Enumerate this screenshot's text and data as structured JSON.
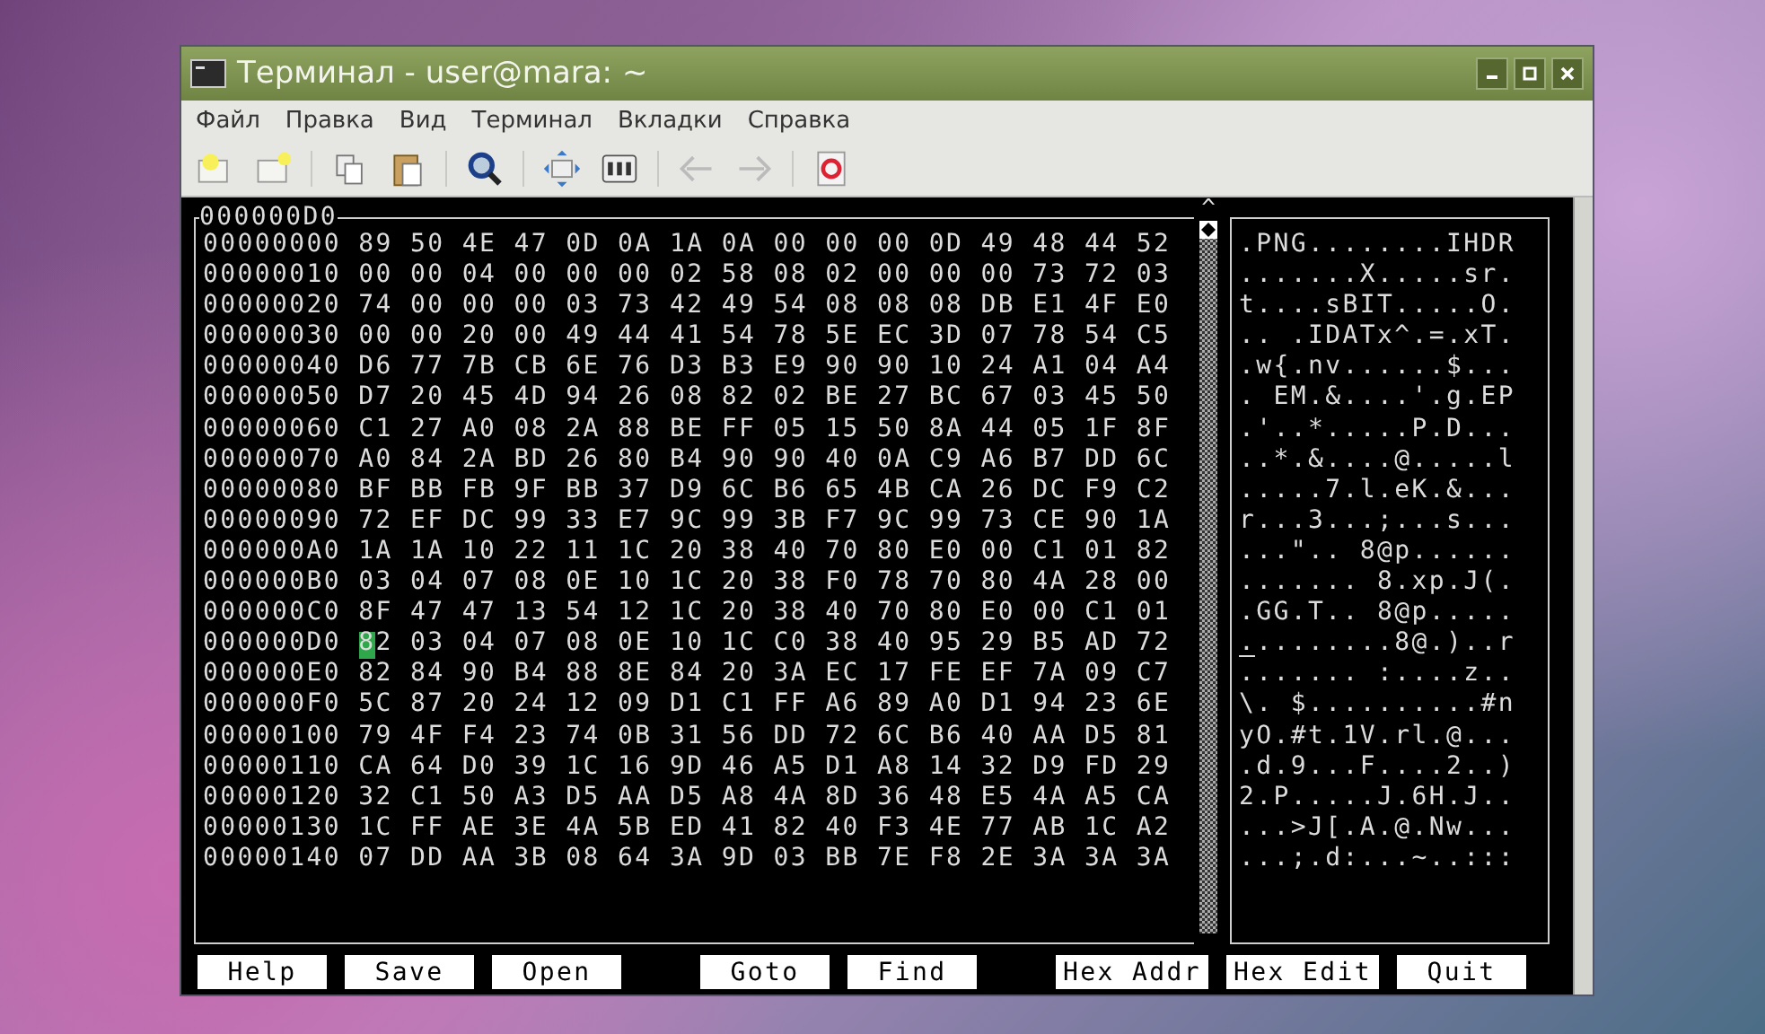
{
  "window": {
    "title": "Терминал - user@mara: ~"
  },
  "menu": [
    "Файл",
    "Правка",
    "Вид",
    "Терминал",
    "Вкладки",
    "Справка"
  ],
  "hex_editor": {
    "frame_label": "000000D0",
    "scroll_up": "^",
    "rows": [
      {
        "address": "00000000",
        "bytes": "89 50 4E 47 0D 0A 1A 0A 00 00 00 0D 49 48 44 52",
        "ascii": ".PNG........IHDR",
        "selected": false
      },
      {
        "address": "00000010",
        "bytes": "00 00 04 00 00 00 02 58 08 02 00 00 00 73 72 03",
        "ascii": ".......X.....sr.",
        "selected": false
      },
      {
        "address": "00000020",
        "bytes": "74 00 00 00 03 73 42 49 54 08 08 08 DB E1 4F E0",
        "ascii": "t....sBIT.....O.",
        "selected": false
      },
      {
        "address": "00000030",
        "bytes": "00 00 20 00 49 44 41 54 78 5E EC 3D 07 78 54 C5",
        "ascii": ".. .IDATx^.=.xT.",
        "selected": false
      },
      {
        "address": "00000040",
        "bytes": "D6 77 7B CB 6E 76 D3 B3 E9 90 90 10 24 A1 04 A4",
        "ascii": ".w{.nv......$...",
        "selected": false
      },
      {
        "address": "00000050",
        "bytes": "D7 20 45 4D 94 26 08 82 02 BE 27 BC 67 03 45 50",
        "ascii": ". EM.&....'.g.EP",
        "selected": false
      },
      {
        "address": "00000060",
        "bytes": "C1 27 A0 08 2A 88 BE FF 05 15 50 8A 44 05 1F 8F",
        "ascii": ".'..*.....P.D...",
        "selected": false
      },
      {
        "address": "00000070",
        "bytes": "A0 84 2A BD 26 80 B4 90 90 40 0A C9 A6 B7 DD 6C",
        "ascii": "..*.&....@.....l",
        "selected": false
      },
      {
        "address": "00000080",
        "bytes": "BF BB FB 9F BB 37 D9 6C B6 65 4B CA 26 DC F9 C2",
        "ascii": ".....7.l.eK.&...",
        "selected": false
      },
      {
        "address": "00000090",
        "bytes": "72 EF DC 99 33 E7 9C 99 3B F7 9C 99 73 CE 90 1A",
        "ascii": "r...3...;...s...",
        "selected": false
      },
      {
        "address": "000000A0",
        "bytes": "1A 1A 10 22 11 1C 20 38 40 70 80 E0 00 C1 01 82",
        "ascii": "...\".. 8@p......",
        "selected": false
      },
      {
        "address": "000000B0",
        "bytes": "03 04 07 08 0E 10 1C 20 38 F0 78 70 80 4A 28 00",
        "ascii": "....... 8.xp.J(.",
        "selected": false
      },
      {
        "address": "000000C0",
        "bytes": "8F 47 47 13 54 12 1C 20 38 40 70 80 E0 00 C1 01",
        "ascii": ".GG.T.. 8@p.....",
        "selected": false
      },
      {
        "address": "000000D0",
        "bytes": "82 03 04 07 08 0E 10 1C C0 38 40 95 29 B5 AD 72",
        "ascii": ".........8@.)..r",
        "selected": true
      },
      {
        "address": "000000E0",
        "bytes": "82 84 90 B4 88 8E 84 20 3A EC 17 FE EF 7A 09 C7",
        "ascii": "....... :....z..",
        "selected": false
      },
      {
        "address": "000000F0",
        "bytes": "5C 87 20 24 12 09 D1 C1 FF A6 89 A0 D1 94 23 6E",
        "ascii": "\\. $..........#n",
        "selected": false
      },
      {
        "address": "00000100",
        "bytes": "79 4F F4 23 74 0B 31 56 DD 72 6C B6 40 AA D5 81",
        "ascii": "yO.#t.1V.rl.@...",
        "selected": false
      },
      {
        "address": "00000110",
        "bytes": "CA 64 D0 39 1C 16 9D 46 A5 D1 A8 14 32 D9 FD 29",
        "ascii": ".d.9...F....2..)",
        "selected": false
      },
      {
        "address": "00000120",
        "bytes": "32 C1 50 A3 D5 AA D5 A8 4A 8D 36 48 E5 4A A5 CA",
        "ascii": "2.P.....J.6H.J..",
        "selected": false
      },
      {
        "address": "00000130",
        "bytes": "1C FF AE 3E 4A 5B ED 41 82 40 F3 4E 77 AB 1C A2",
        "ascii": "...>J[.A.@.Nw...",
        "selected": false
      },
      {
        "address": "00000140",
        "bytes": "07 DD AA 3B 08 64 3A 9D 03 BB 7E F8 2E 3A 3A 3A",
        "ascii": "...;.d:...~..:::",
        "selected": false
      }
    ]
  },
  "function_keys": [
    {
      "kind": "key",
      "label": "Help"
    },
    {
      "kind": "key",
      "label": "Save"
    },
    {
      "kind": "key",
      "label": "Open"
    },
    {
      "kind": "gap"
    },
    {
      "kind": "key",
      "label": "Goto"
    },
    {
      "kind": "key",
      "label": "Find"
    },
    {
      "kind": "gap"
    },
    {
      "kind": "key",
      "label": "Hex Addr"
    },
    {
      "kind": "key",
      "label": "Hex Edit"
    },
    {
      "kind": "key",
      "label": "Quit"
    }
  ]
}
